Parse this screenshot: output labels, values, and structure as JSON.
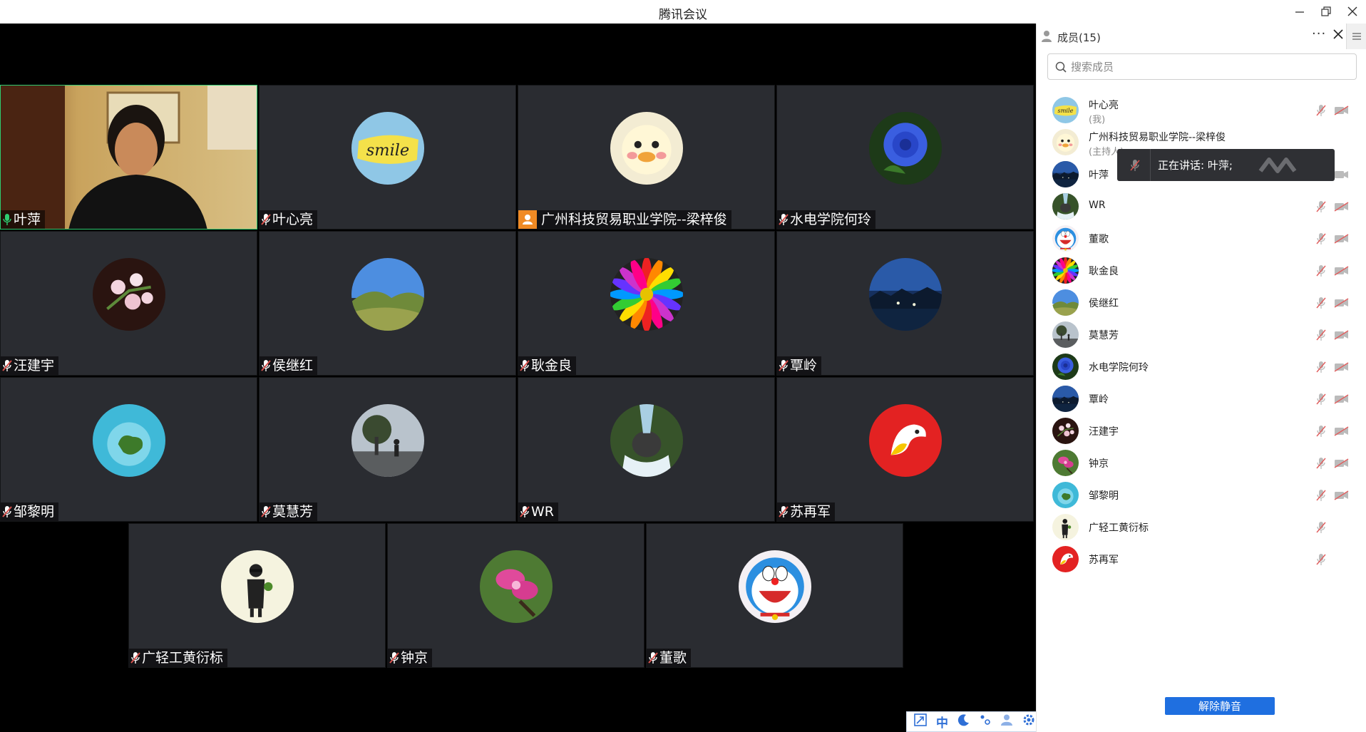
{
  "window": {
    "title": "腾讯会议",
    "controls": [
      "minimize",
      "restore",
      "close"
    ]
  },
  "grid": {
    "tiles": [
      {
        "name": "叶萍",
        "mic": "on",
        "type": "video",
        "speaking": true
      },
      {
        "name": "叶心亮",
        "mic": "muted",
        "type": "avatar",
        "avatar": "smile"
      },
      {
        "name": "广州科技贸易职业学院--梁梓俊",
        "mic": "host",
        "type": "avatar",
        "avatar": "duck"
      },
      {
        "name": "水电学院何玲",
        "mic": "muted",
        "type": "avatar",
        "avatar": "blue-rose"
      },
      {
        "name": "汪建宇",
        "mic": "muted",
        "type": "avatar",
        "avatar": "blossom"
      },
      {
        "name": "侯继红",
        "mic": "muted",
        "type": "avatar",
        "avatar": "hills"
      },
      {
        "name": "耿金良",
        "mic": "muted",
        "type": "avatar",
        "avatar": "rainbow-flower"
      },
      {
        "name": "覃岭",
        "mic": "muted",
        "type": "avatar",
        "avatar": "night-lake"
      },
      {
        "name": "邹黎明",
        "mic": "muted",
        "type": "avatar",
        "avatar": "island"
      },
      {
        "name": "莫慧芳",
        "mic": "muted",
        "type": "avatar",
        "avatar": "tree-walker"
      },
      {
        "name": "WR",
        "mic": "muted",
        "type": "avatar",
        "avatar": "waterfall"
      },
      {
        "name": "苏再军",
        "mic": "muted",
        "type": "avatar",
        "avatar": "red-bird"
      },
      {
        "name": "广轻工黄衍标",
        "mic": "muted",
        "type": "avatar",
        "avatar": "man-cartoon"
      },
      {
        "name": "钟京",
        "mic": "muted",
        "type": "avatar",
        "avatar": "pink-orchid"
      },
      {
        "name": "董歌",
        "mic": "muted",
        "type": "avatar",
        "avatar": "doraemon"
      }
    ]
  },
  "tray": {
    "items": [
      {
        "icon": "share-icon",
        "label": ""
      },
      {
        "icon": "chinese-input-icon",
        "label": "中"
      },
      {
        "icon": "moon-icon",
        "label": ""
      },
      {
        "icon": "punctuation-icon",
        "label": ""
      },
      {
        "icon": "user-icon",
        "label": ""
      },
      {
        "icon": "gear-icon",
        "label": ""
      }
    ]
  },
  "panel": {
    "title": "成员(15)",
    "more_label": "···",
    "search_placeholder": "搜索成员",
    "members": [
      {
        "name": "叶心亮",
        "sub": "(我)",
        "avatar": "smile",
        "mic": "muted",
        "cam": "off"
      },
      {
        "name": "广州科技贸易职业学院--梁梓俊",
        "sub": "(主持人)",
        "avatar": "duck",
        "mic": "none",
        "cam": "none"
      },
      {
        "name": "叶萍",
        "sub": "",
        "avatar": "night-lake",
        "mic": "on",
        "cam": "on"
      },
      {
        "name": "WR",
        "sub": "",
        "avatar": "waterfall",
        "mic": "muted",
        "cam": "off"
      },
      {
        "name": "董歌",
        "sub": "",
        "avatar": "doraemon",
        "mic": "muted",
        "cam": "off"
      },
      {
        "name": "耿金良",
        "sub": "",
        "avatar": "rainbow-flower",
        "mic": "muted",
        "cam": "off"
      },
      {
        "name": "侯继红",
        "sub": "",
        "avatar": "hills",
        "mic": "muted",
        "cam": "off"
      },
      {
        "name": "莫慧芳",
        "sub": "",
        "avatar": "tree-walker",
        "mic": "muted",
        "cam": "off"
      },
      {
        "name": "水电学院何玲",
        "sub": "",
        "avatar": "blue-rose",
        "mic": "muted",
        "cam": "off"
      },
      {
        "name": "覃岭",
        "sub": "",
        "avatar": "night-lake",
        "mic": "muted",
        "cam": "off"
      },
      {
        "name": "汪建宇",
        "sub": "",
        "avatar": "blossom",
        "mic": "muted",
        "cam": "off"
      },
      {
        "name": "钟京",
        "sub": "",
        "avatar": "pink-orchid",
        "mic": "muted",
        "cam": "off"
      },
      {
        "name": "邹黎明",
        "sub": "",
        "avatar": "island",
        "mic": "muted",
        "cam": "off"
      },
      {
        "name": "广轻工黄衍标",
        "sub": "",
        "avatar": "man-cartoon",
        "mic": "muted",
        "cam": "none"
      },
      {
        "name": "苏再军",
        "sub": "",
        "avatar": "red-bird",
        "mic": "muted",
        "cam": "none"
      }
    ],
    "unmute_label": "解除静音"
  },
  "tooltip": {
    "text": "正在讲话: 叶萍;"
  },
  "colors": {
    "accent": "#1f6fe0",
    "host_badge": "#f08a24",
    "speaking_border": "#2ecc71",
    "mic_muted": "#d9534f"
  }
}
